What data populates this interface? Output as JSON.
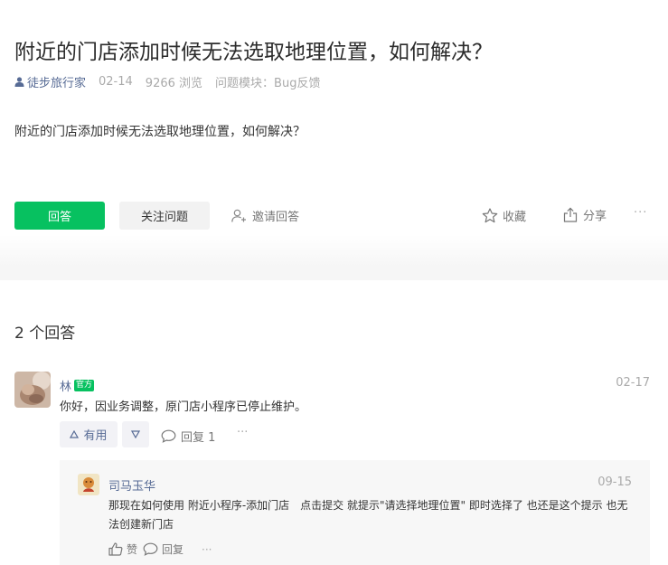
{
  "question": {
    "title": "附近的门店添加时候无法选取地理位置，如何解决？",
    "author": "徒步旅行家",
    "date": "02-14",
    "views": "9266 浏览",
    "module_label": "问题模块：",
    "module": "Bug反馈",
    "body": "附近的门店添加时候无法选取地理位置，如何解决？"
  },
  "actions": {
    "answer": "回答",
    "follow": "关注问题",
    "invite": "邀请回答",
    "collect": "收藏",
    "share": "分享",
    "more": "···"
  },
  "answers_header": "2 个回答",
  "answer": {
    "author": "林",
    "badge": "官方",
    "date": "02-17",
    "text": "你好，因业务调整，原门店小程序已停止维护。",
    "useful": "有用",
    "reply": "回复 1",
    "more": "···"
  },
  "sub_reply": {
    "author": "司马玉华",
    "date": "09-15",
    "text": "那现在如何使用 附近小程序-添加门店　点击提交 就提示\"请选择地理位置\" 即时选择了 也还是这个提示 也无法创建新门店",
    "like": "赞",
    "reply": "回复",
    "more": "···"
  },
  "colors": {
    "brand_green": "#07c160",
    "link_blue": "#576b95"
  }
}
